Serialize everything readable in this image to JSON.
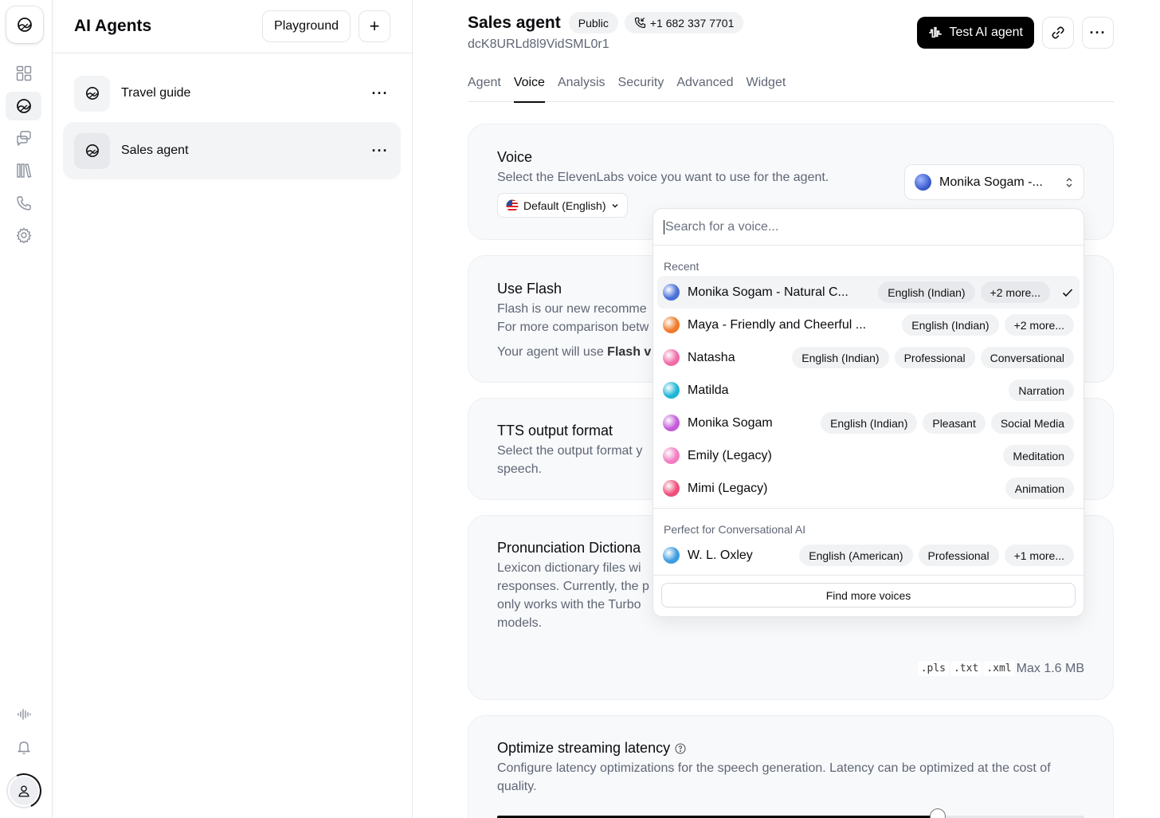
{
  "rail": {
    "items": [
      {
        "icon": "grid-icon",
        "active": false
      },
      {
        "icon": "agent-logo-icon",
        "active": true
      },
      {
        "icon": "chat-icon",
        "active": false
      },
      {
        "icon": "library-icon",
        "active": false
      },
      {
        "icon": "phone-icon",
        "active": false
      },
      {
        "icon": "gear-icon",
        "active": false
      }
    ],
    "bottom": [
      "waveform-icon",
      "bell-icon",
      "user-icon"
    ]
  },
  "agents_panel": {
    "title": "AI Agents",
    "playground_label": "Playground",
    "add_label": "+",
    "agents": [
      {
        "name": "Travel guide",
        "selected": false
      },
      {
        "name": "Sales agent",
        "selected": true
      }
    ]
  },
  "header": {
    "agent_name": "Sales agent",
    "visibility": "Public",
    "phone": "+1 682 337 7701",
    "agent_id": "dcK8URLd8l9VidSML0r1",
    "test_label": "Test AI agent"
  },
  "tabs": [
    {
      "label": "Agent",
      "active": false
    },
    {
      "label": "Voice",
      "active": true
    },
    {
      "label": "Analysis",
      "active": false
    },
    {
      "label": "Security",
      "active": false
    },
    {
      "label": "Advanced",
      "active": false
    },
    {
      "label": "Widget",
      "active": false
    }
  ],
  "voice_card": {
    "title": "Voice",
    "description": "Select the ElevenLabs voice you want to use for the agent.",
    "language": "Default (English)",
    "selected_voice": "Monika Sogam -..."
  },
  "flash_card": {
    "title": "Use Flash",
    "line1": "Flash is our new recomme",
    "line2": "For more comparison betw",
    "line3_prefix": "Your agent will use ",
    "line3_bold": "Flash v"
  },
  "tts_card": {
    "title": "TTS output format",
    "line1": "Select the output format y",
    "line2": "speech."
  },
  "pronunciation_card": {
    "title": "Pronunciation Dictiona",
    "lines": [
      "Lexicon dictionary files wi",
      "responses. Currently, the p",
      "only works with the Turbo",
      "models."
    ],
    "file_types": [
      ".pls",
      ".txt",
      ".xml"
    ],
    "max_size": "Max 1.6 MB"
  },
  "latency_card": {
    "title": "Optimize streaming latency",
    "description": "Configure latency optimizations for the speech generation. Latency can be optimized at the cost of quality.",
    "slider_fraction": 0.75
  },
  "voice_dropdown": {
    "search_placeholder": "Search for a voice...",
    "groups": [
      {
        "label": "Recent",
        "voices": [
          {
            "name": "Monika Sogam - Natural C...",
            "tags": [
              "English (Indian)",
              "+2 more..."
            ],
            "selected": true,
            "color": "#4a6fd8"
          },
          {
            "name": "Maya - Friendly and Cheerful ...",
            "tags": [
              "English (Indian)",
              "+2 more..."
            ],
            "selected": false,
            "color": "#f07a2a"
          },
          {
            "name": "Natasha",
            "tags": [
              "English (Indian)",
              "Professional",
              "Conversational"
            ],
            "selected": false,
            "color": "#f06ba8"
          },
          {
            "name": "Matilda",
            "tags": [
              "Narration"
            ],
            "selected": false,
            "color": "#1fb5d6"
          },
          {
            "name": "Monika Sogam",
            "tags": [
              "English (Indian)",
              "Pleasant",
              "Social Media"
            ],
            "selected": false,
            "color": "#c45ad9"
          },
          {
            "name": "Emily (Legacy)",
            "tags": [
              "Meditation"
            ],
            "selected": false,
            "color": "#f27cc0"
          },
          {
            "name": "Mimi (Legacy)",
            "tags": [
              "Animation"
            ],
            "selected": false,
            "color": "#ee4f7a"
          }
        ]
      },
      {
        "label": "Perfect for Conversational AI",
        "voices": [
          {
            "name": "W. L. Oxley",
            "tags": [
              "English (American)",
              "Professional",
              "+1 more..."
            ],
            "selected": false,
            "color": "#3d9be0"
          }
        ]
      }
    ],
    "find_more_label": "Find more voices"
  }
}
